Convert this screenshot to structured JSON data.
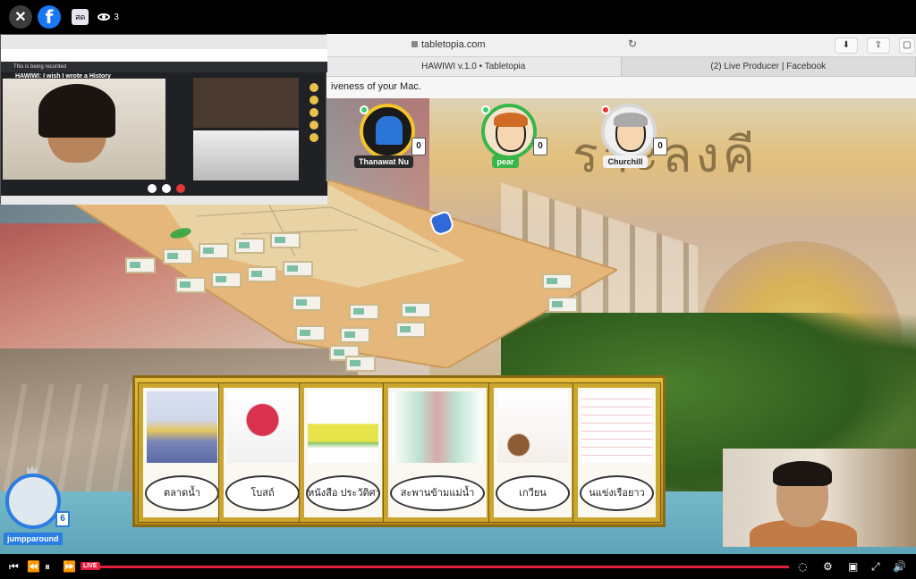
{
  "facebook": {
    "live_badge": "สด",
    "viewer_count": "3",
    "live_label": "LIVE"
  },
  "browser": {
    "url": "tabletopia.com",
    "tabs": [
      "HAWIWI v.1.0 • Tabletopia",
      "(2) Live Producer | Facebook"
    ],
    "info_bar": "iveness of your Mac."
  },
  "call": {
    "recording_note": "This is being recorded",
    "meeting_title": "HAWIWI: I wish I wrote a History"
  },
  "players": [
    {
      "name": "Thanawat Nu",
      "score": "0",
      "style": "meeple"
    },
    {
      "name": "pear",
      "score": "0",
      "style": "cartoon"
    },
    {
      "name": "Churchill",
      "score": "0",
      "style": "old-man"
    }
  ],
  "host": {
    "name": "jumpparound",
    "score": "6"
  },
  "hand_cards": [
    {
      "label": "ตลาดน้ำ"
    },
    {
      "label": "โบสถ์"
    },
    {
      "label": "หนังสือ ประวัติศาสตร์"
    },
    {
      "label": "สะพานข้ามแม่น้ำ"
    },
    {
      "label": "เกวียน"
    },
    {
      "label": "นแข่งเรือยาว"
    }
  ],
  "colors": {
    "fb_blue": "#1877f2",
    "live_red": "#e41e3f",
    "gold_frame": "#caa62e",
    "host_blue": "#2a7de1"
  }
}
